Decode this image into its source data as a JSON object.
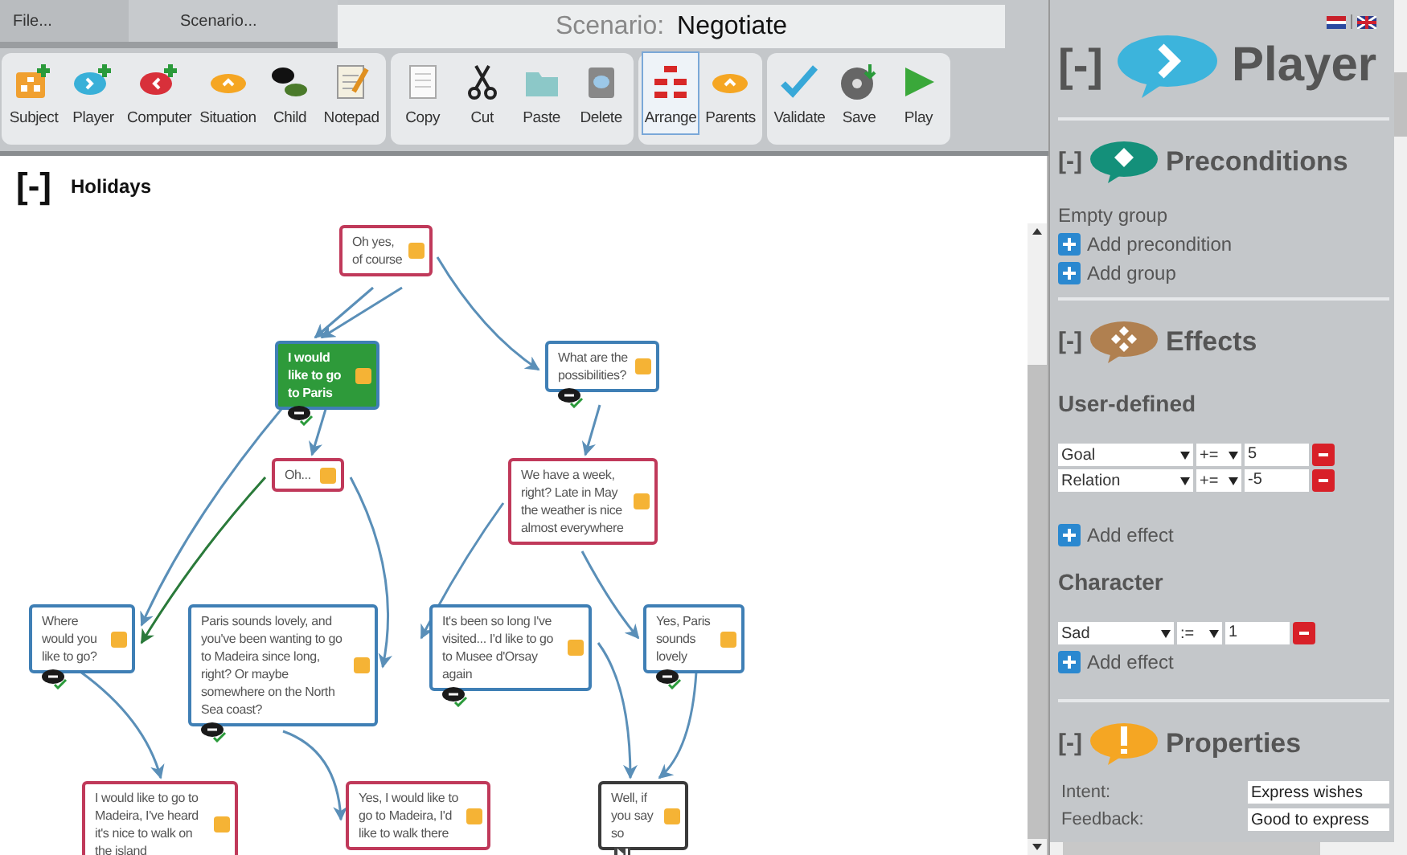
{
  "menu_tabs": [
    {
      "label": "File...",
      "selected": false
    },
    {
      "label": "Scenario...",
      "selected": true
    }
  ],
  "title": {
    "label": "Scenario:",
    "value": "Negotiate"
  },
  "toolbar": {
    "groups": [
      [
        {
          "label": "Subject",
          "selected": false
        },
        {
          "label": "Player",
          "selected": false
        },
        {
          "label": "Computer",
          "selected": false
        },
        {
          "label": "Situation",
          "selected": false
        },
        {
          "label": "Child",
          "selected": false
        },
        {
          "label": "Notepad",
          "selected": false
        }
      ],
      [
        {
          "label": "Copy",
          "selected": false
        },
        {
          "label": "Cut",
          "selected": false
        },
        {
          "label": "Paste",
          "selected": false
        },
        {
          "label": "Delete",
          "selected": false
        }
      ],
      [
        {
          "label": "Arrange",
          "selected": true
        },
        {
          "label": "Parents",
          "selected": false
        }
      ],
      [
        {
          "label": "Validate",
          "selected": false
        },
        {
          "label": "Save",
          "selected": false
        },
        {
          "label": "Play",
          "selected": false
        }
      ]
    ]
  },
  "canvas": {
    "collapse": "[-]",
    "title": "Holidays",
    "nodes": [
      {
        "text": "Oh yes, of course",
        "kind": "computer",
        "selected": false
      },
      {
        "text": "I would like to go to Paris",
        "kind": "player",
        "selected": true
      },
      {
        "text": "What are the possibilities?",
        "kind": "player",
        "selected": false
      },
      {
        "text": "Oh...",
        "kind": "computer",
        "selected": false
      },
      {
        "text": "We have a week, right? Late in May the weather is nice almost everywhere",
        "kind": "computer",
        "selected": false
      },
      {
        "text": "Where would you like to go?",
        "kind": "player",
        "selected": false
      },
      {
        "text": "Paris sounds lovely, and you've been wanting to go to Madeira since long, right? Or maybe somewhere on the North Sea coast?",
        "kind": "player",
        "selected": false
      },
      {
        "text": "It's been so long I've visited... I'd like to go to Musee d'Orsay again",
        "kind": "player",
        "selected": false
      },
      {
        "text": "Yes, Paris sounds lovely",
        "kind": "player",
        "selected": false
      },
      {
        "text": "I would like to go to Madeira, I've heard it's nice to walk on the island",
        "kind": "computer",
        "selected": false
      },
      {
        "text": "Yes, I would like to go to Madeira, I'd like to walk there",
        "kind": "computer",
        "selected": false
      },
      {
        "text": "Well, if you say so",
        "kind": "end",
        "selected": false
      }
    ]
  },
  "panel": {
    "collapse": "[-]",
    "title": "Player",
    "preconditions": {
      "collapse": "[-]",
      "title": "Preconditions",
      "empty": "Empty group",
      "actions": [
        "Add precondition",
        "Add group"
      ]
    },
    "effects": {
      "collapse": "[-]",
      "title": "Effects",
      "groups": [
        {
          "title": "User-defined",
          "rows": [
            {
              "name": "Goal",
              "op": "+=",
              "value": "5"
            },
            {
              "name": "Relation",
              "op": "+=",
              "value": "-5"
            }
          ],
          "action": "Add effect"
        },
        {
          "title": "Character",
          "rows": [
            {
              "name": "Sad",
              "op": ":=",
              "value": "1"
            }
          ],
          "action": "Add effect"
        }
      ]
    },
    "properties": {
      "collapse": "[-]",
      "title": "Properties",
      "fields": [
        {
          "label": "Intent:",
          "value": "Express wishes"
        },
        {
          "label": "Feedback:",
          "value": "Good to express"
        }
      ]
    }
  }
}
